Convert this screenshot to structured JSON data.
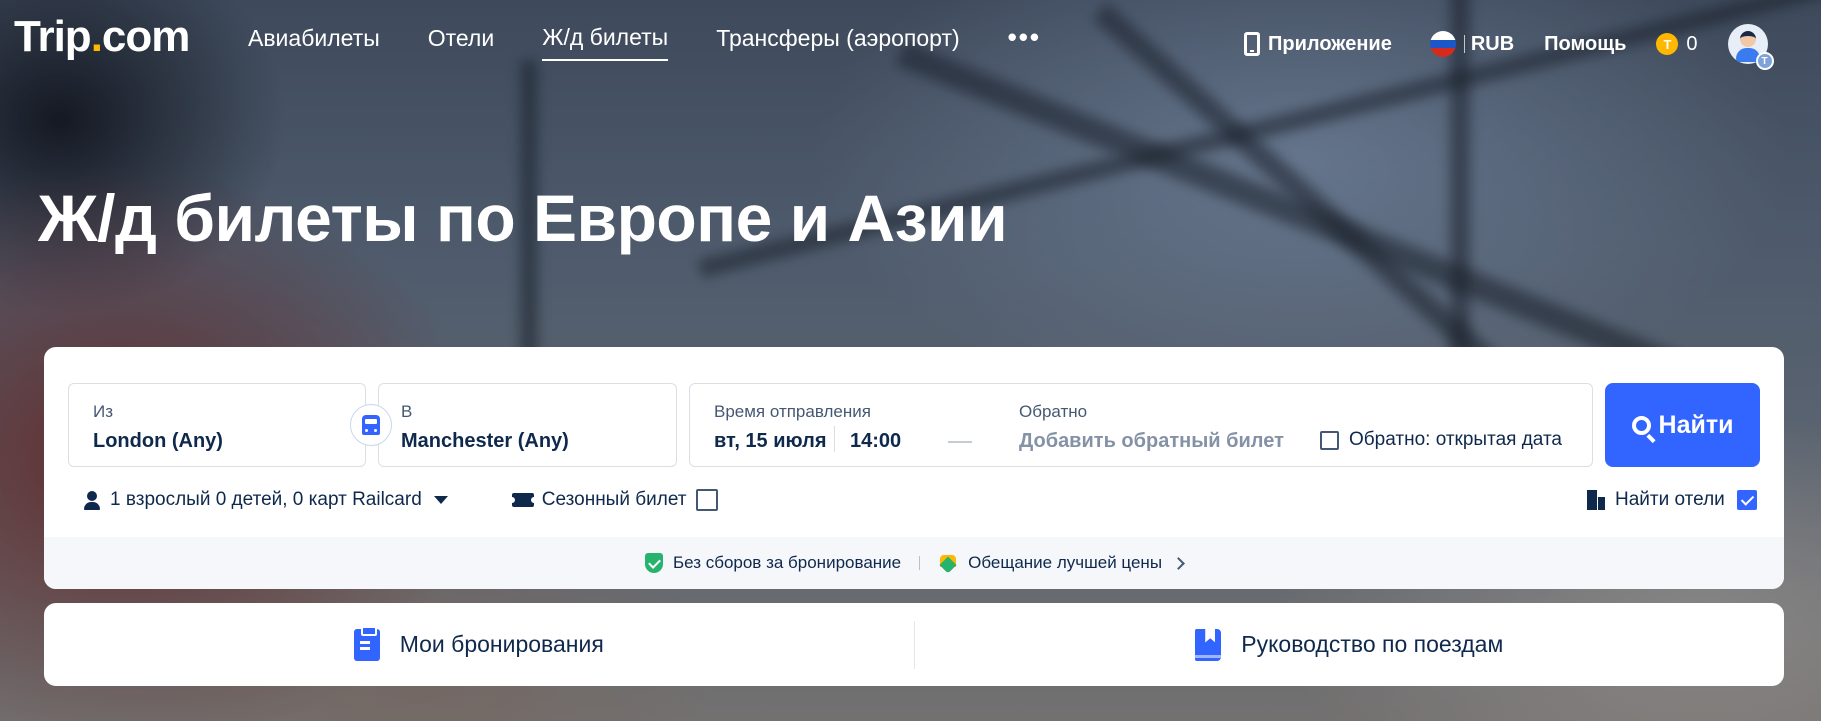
{
  "brand": {
    "logo_main": "Trip",
    "logo_dot": ".",
    "logo_end": "com"
  },
  "nav": {
    "items": [
      {
        "label": "Авиабилеты"
      },
      {
        "label": "Отели"
      },
      {
        "label": "Ж/д билеты"
      },
      {
        "label": "Трансферы (аэропорт)"
      }
    ],
    "more": "•••"
  },
  "header_right": {
    "app": "Приложение",
    "currency": "RUB",
    "help": "Помощь",
    "coin_symbol": "T",
    "coins": "0",
    "avatar_badge": "T"
  },
  "hero": {
    "title": "Ж/д билеты по Европе и Азии"
  },
  "search": {
    "from_label": "Из",
    "from_value": "London (Any)",
    "to_label": "В",
    "to_value": "Manchester (Any)",
    "depart_label": "Время отправления",
    "depart_date": "вт, 15 июля",
    "depart_time": "14:00",
    "return_label": "Обратно",
    "return_value": "Добавить обратный билет",
    "open_return": "Обратно: открытая дата",
    "button": "Найти"
  },
  "options": {
    "passengers": "1 взрослый 0 детей, 0 карт Railcard",
    "season": "Сезонный билет",
    "hotels": "Найти отели"
  },
  "promo": {
    "no_fees": "Без сборов за бронирование",
    "best_price": "Обещание лучшей цены"
  },
  "links": {
    "bookings": "Мои бронирования",
    "guide": "Руководство по поездам"
  },
  "colors": {
    "primary": "#3264ff",
    "accent": "#ffb800",
    "text": "#0f294d"
  },
  "icons": [
    "phone-icon",
    "russia-flag-icon",
    "trip-coin-icon",
    "avatar",
    "train-swap-icon",
    "search-icon",
    "person-icon",
    "ticket-icon",
    "building-icon",
    "shield-check-icon",
    "price-promise-icon",
    "chevron-right-icon",
    "clipboard-icon",
    "book-icon"
  ]
}
